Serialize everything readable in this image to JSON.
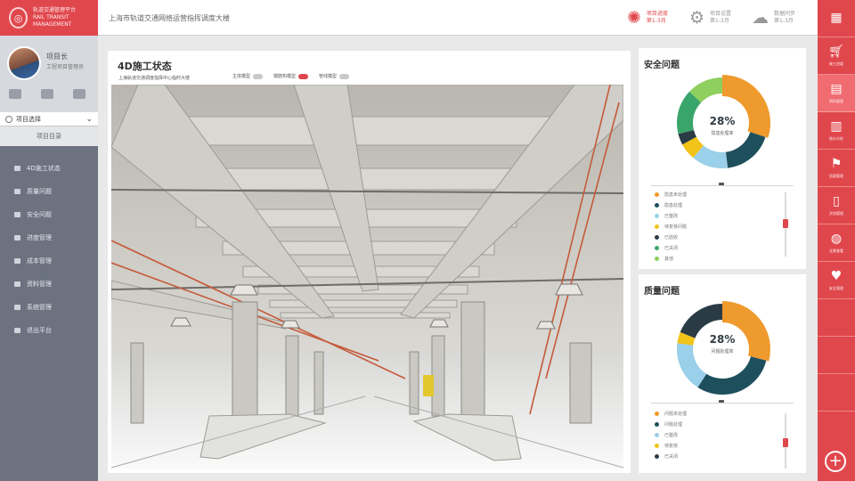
{
  "brand": {
    "line1": "轨道交通管理平台",
    "line2": "RAIL TRANSIT MANAGEMENT"
  },
  "profile": {
    "name": "项目长",
    "role": "工程项目管理员"
  },
  "project_select": {
    "value": "项目选择"
  },
  "nav": {
    "top_label": "项目目录",
    "items": [
      {
        "label": "4D施工状态"
      },
      {
        "label": "质量问题"
      },
      {
        "label": "安全问题"
      },
      {
        "label": "进度管理"
      },
      {
        "label": "成本管理"
      },
      {
        "label": "资料管理"
      },
      {
        "label": "系统管理"
      },
      {
        "label": "退出平台"
      }
    ]
  },
  "header": {
    "title": "上海市轨道交通网络运营指挥调度大楼",
    "buttons": [
      {
        "icon": "sun-icon",
        "label1": "项目进度",
        "label2": "第1-3月",
        "color": "#e0474d"
      },
      {
        "icon": "gear-icon",
        "label1": "项目设置",
        "label2": "第1-3月",
        "color": "#999999"
      },
      {
        "icon": "cloud-icon",
        "label1": "数据同步",
        "label2": "第1-3月",
        "color": "#999999"
      }
    ]
  },
  "main": {
    "title": "4D施工状态",
    "subtitle": "上海轨道交通调度指挥中心临时大楼",
    "toggles": [
      {
        "label": "主体模型",
        "on": false
      },
      {
        "label": "钢筋构模型",
        "on": true
      },
      {
        "label": "管线模型",
        "on": false
      }
    ]
  },
  "safety_panel": {
    "title": "安全问题",
    "center_value": "28%",
    "center_label": "隐患处理率",
    "segments": [
      {
        "value": 30,
        "color": "#ef9a2c"
      },
      {
        "value": 18,
        "color": "#1e4f5c"
      },
      {
        "value": 13,
        "color": "#9ad0e9"
      },
      {
        "value": 6,
        "color": "#f2c318"
      },
      {
        "value": 4,
        "color": "#2b3b45"
      },
      {
        "value": 16,
        "color": "#3aa56b"
      },
      {
        "value": 13,
        "color": "#8fcf5d"
      }
    ],
    "legend": [
      {
        "label": "隐患未处理",
        "color": "#ef9a2c"
      },
      {
        "label": "隐患处理",
        "color": "#1e4f5c"
      },
      {
        "label": "已整改",
        "color": "#9ad0e9"
      },
      {
        "label": "待复核问题",
        "color": "#f2c318"
      },
      {
        "label": "已验收",
        "color": "#2b3b45"
      },
      {
        "label": "已关闭",
        "color": "#3aa56b"
      },
      {
        "label": "其他",
        "color": "#8fcf5d"
      }
    ]
  },
  "quality_panel": {
    "title": "质量问题",
    "center_value": "28%",
    "center_label": "问题处理率",
    "segments": [
      {
        "value": 29,
        "color": "#ef9a2c"
      },
      {
        "value": 30,
        "color": "#1e4f5c"
      },
      {
        "value": 18,
        "color": "#9ad0e9"
      },
      {
        "value": 4,
        "color": "#f2c318"
      },
      {
        "value": 19,
        "color": "#2b3b45"
      }
    ],
    "legend": [
      {
        "label": "问题未处理",
        "color": "#ef9a2c"
      },
      {
        "label": "问题处理",
        "color": "#1e4f5c"
      },
      {
        "label": "已整改",
        "color": "#9ad0e9"
      },
      {
        "label": "待复核",
        "color": "#f2c318"
      },
      {
        "label": "已关闭",
        "color": "#2b3b45"
      }
    ]
  },
  "rightbar": {
    "items": [
      {
        "icon": "grid-icon",
        "label": ""
      },
      {
        "icon": "cart-icon",
        "label": "施工进度"
      },
      {
        "icon": "book-icon",
        "label": "资料管理"
      },
      {
        "icon": "chart-icon",
        "label": "统计分析"
      },
      {
        "icon": "flag-icon",
        "label": "质量管理"
      },
      {
        "icon": "file-icon",
        "label": "文档管理"
      },
      {
        "icon": "globe-icon",
        "label": "全景查看"
      },
      {
        "icon": "heart-icon",
        "label": "安全管理"
      }
    ],
    "add_label": "+"
  }
}
